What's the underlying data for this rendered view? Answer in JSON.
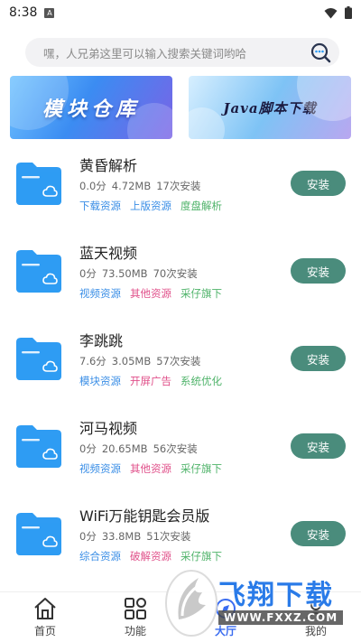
{
  "status_bar": {
    "time": "8:38",
    "notification_badge": "A"
  },
  "search": {
    "placeholder": "嘿，人兄弟这里可以输入搜索关键词哟哈"
  },
  "banners": [
    {
      "text": "模块仓库"
    },
    {
      "text": "Java脚本下载"
    }
  ],
  "items": [
    {
      "name": "黄昏解析",
      "score": "0.0分",
      "size": "4.72MB",
      "installs": "17次安装",
      "button": "安装",
      "tags": [
        {
          "text": "下载资源",
          "color": "#3a8ee6"
        },
        {
          "text": "上版资源",
          "color": "#3a8ee6"
        },
        {
          "text": "度盘解析",
          "color": "#4fb36a"
        }
      ]
    },
    {
      "name": "蓝天视频",
      "score": "0分",
      "size": "73.50MB",
      "installs": "70次安装",
      "button": "安装",
      "tags": [
        {
          "text": "视频资源",
          "color": "#3a8ee6"
        },
        {
          "text": "其他资源",
          "color": "#e0508a"
        },
        {
          "text": "采仔旗下",
          "color": "#4fb36a"
        }
      ]
    },
    {
      "name": "李跳跳",
      "score": "7.6分",
      "size": "3.05MB",
      "installs": "57次安装",
      "button": "安装",
      "tags": [
        {
          "text": "模块资源",
          "color": "#3a8ee6"
        },
        {
          "text": "开屏广告",
          "color": "#e0508a"
        },
        {
          "text": "系统优化",
          "color": "#4fb36a"
        }
      ]
    },
    {
      "name": "河马视频",
      "score": "0分",
      "size": "20.65MB",
      "installs": "56次安装",
      "button": "安装",
      "tags": [
        {
          "text": "视频资源",
          "color": "#3a8ee6"
        },
        {
          "text": "其他资源",
          "color": "#e0508a"
        },
        {
          "text": "采仔旗下",
          "color": "#4fb36a"
        }
      ]
    },
    {
      "name": "WiFi万能钥匙会员版",
      "score": "0分",
      "size": "33.8MB",
      "installs": "51次安装",
      "button": "安装",
      "tags": [
        {
          "text": "综合资源",
          "color": "#3a8ee6"
        },
        {
          "text": "破解资源",
          "color": "#e0508a"
        },
        {
          "text": "采仔旗下",
          "color": "#4fb36a"
        }
      ]
    }
  ],
  "bottom_nav": [
    {
      "label": "首页",
      "icon": "home-icon",
      "active": false
    },
    {
      "label": "功能",
      "icon": "grid-icon",
      "active": false
    },
    {
      "label": "大厅",
      "icon": "hall-icon",
      "active": true
    },
    {
      "label": "我的",
      "icon": "profile-icon",
      "active": false
    }
  ],
  "watermark": {
    "title": "飞翔下载",
    "url": "WWW.FXXZ.COM"
  },
  "colors": {
    "install_button": "#4a8c7c",
    "folder": "#2f9cf3",
    "active_tab": "#3a6cf0"
  }
}
